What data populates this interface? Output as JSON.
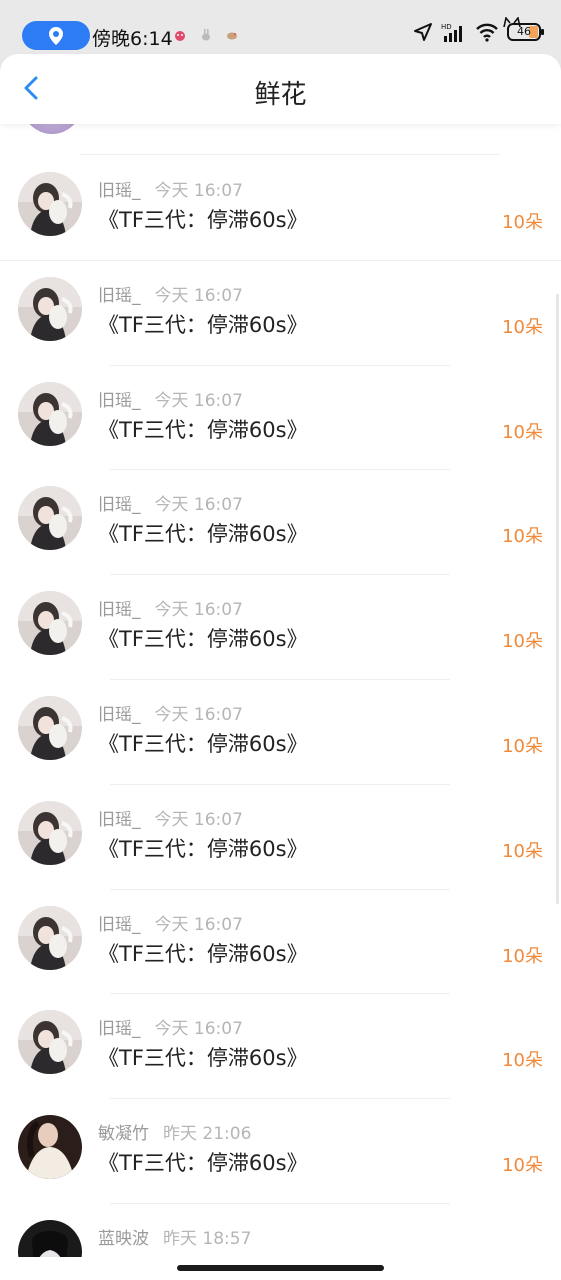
{
  "status": {
    "time": "傍晚6:14",
    "battery": "46"
  },
  "header": {
    "title": "鲜花"
  },
  "rows": [
    {
      "name": "旧瑶_",
      "time": "今天 16:07",
      "message": "《TF三代：停滞60s》",
      "amount": "10朵",
      "avatar": "avatar-girl"
    },
    {
      "name": "旧瑶_",
      "time": "今天 16:07",
      "message": "《TF三代：停滞60s》",
      "amount": "10朵",
      "avatar": "avatar-girl"
    },
    {
      "name": "旧瑶_",
      "time": "今天 16:07",
      "message": "《TF三代：停滞60s》",
      "amount": "10朵",
      "avatar": "avatar-girl"
    },
    {
      "name": "旧瑶_",
      "time": "今天 16:07",
      "message": "《TF三代：停滞60s》",
      "amount": "10朵",
      "avatar": "avatar-girl"
    },
    {
      "name": "旧瑶_",
      "time": "今天 16:07",
      "message": "《TF三代：停滞60s》",
      "amount": "10朵",
      "avatar": "avatar-girl"
    },
    {
      "name": "旧瑶_",
      "time": "今天 16:07",
      "message": "《TF三代：停滞60s》",
      "amount": "10朵",
      "avatar": "avatar-girl"
    },
    {
      "name": "旧瑶_",
      "time": "今天 16:07",
      "message": "《TF三代：停滞60s》",
      "amount": "10朵",
      "avatar": "avatar-girl"
    },
    {
      "name": "旧瑶_",
      "time": "今天 16:07",
      "message": "《TF三代：停滞60s》",
      "amount": "10朵",
      "avatar": "avatar-girl"
    },
    {
      "name": "旧瑶_",
      "time": "今天 16:07",
      "message": "《TF三代：停滞60s》",
      "amount": "10朵",
      "avatar": "avatar-girl"
    },
    {
      "name": "敏凝竹",
      "time": "昨天 21:06",
      "message": "《TF三代：停滞60s》",
      "amount": "10朵",
      "avatar": "avatar-woman"
    },
    {
      "name": "蓝映波",
      "time": "昨天 18:57",
      "message": "",
      "amount": "",
      "avatar": "avatar-dark"
    }
  ]
}
